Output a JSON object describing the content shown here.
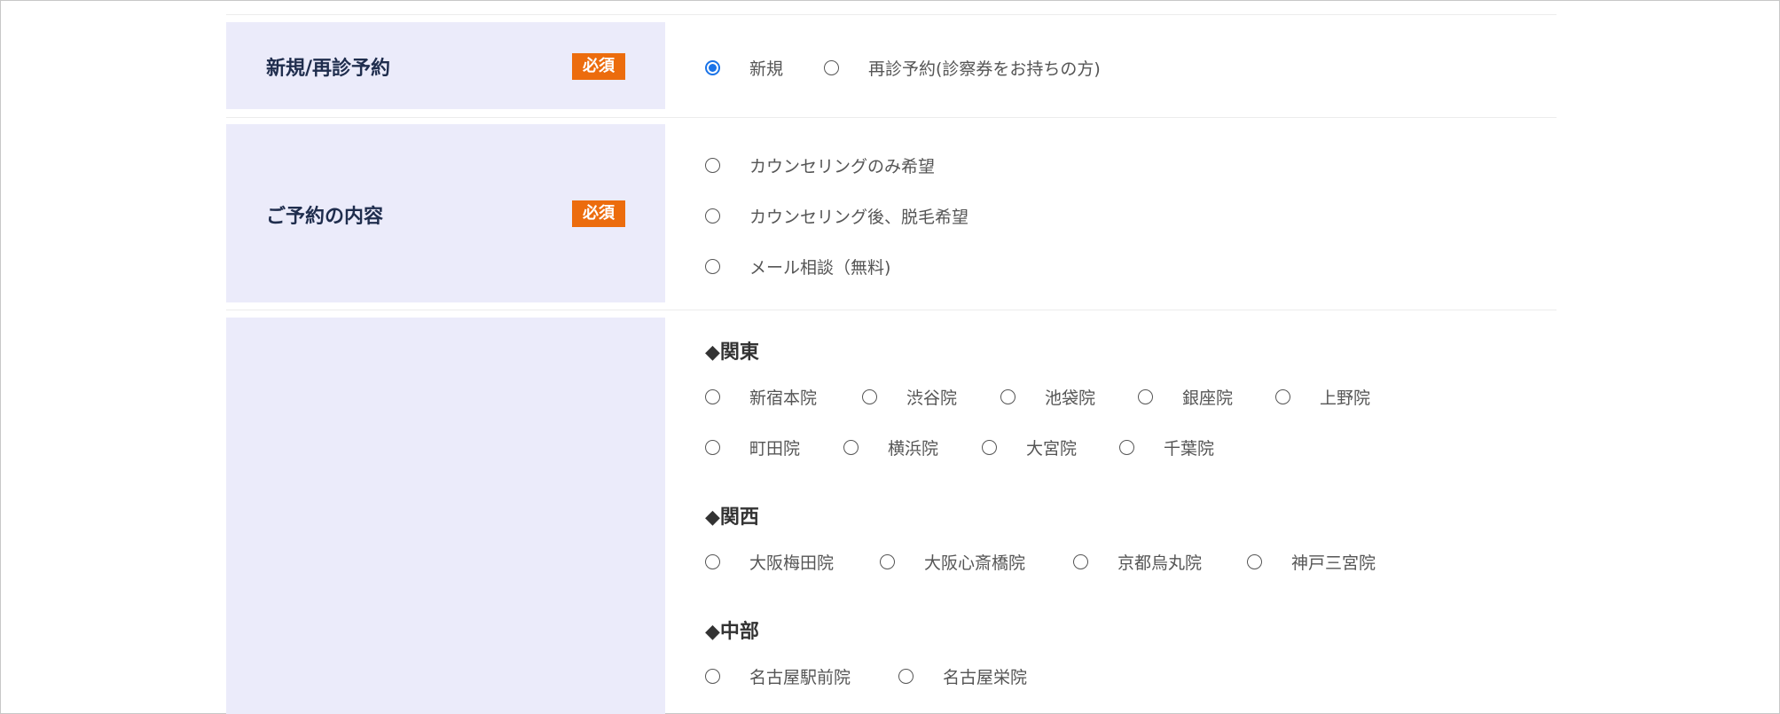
{
  "badge": "必須",
  "visit_type": {
    "label": "新規/再診予約",
    "options": [
      {
        "label": "新規",
        "selected": true
      },
      {
        "label": "再診予約(診察券をお持ちの方)",
        "selected": false
      }
    ]
  },
  "reservation": {
    "label": "ご予約の内容",
    "options": [
      {
        "label": "カウンセリングのみ希望",
        "selected": false
      },
      {
        "label": "カウンセリング後、脱毛希望",
        "selected": false
      },
      {
        "label": "メール相談（無料)",
        "selected": false
      }
    ]
  },
  "clinics": {
    "regions": [
      {
        "heading": "◆関東",
        "clinics": [
          "新宿本院",
          "渋谷院",
          "池袋院",
          "銀座院",
          "上野院",
          "町田院",
          "横浜院",
          "大宮院",
          "千葉院"
        ]
      },
      {
        "heading": "◆関西",
        "clinics": [
          "大阪梅田院",
          "大阪心斎橋院",
          "京都烏丸院",
          "神戸三宮院"
        ]
      },
      {
        "heading": "◆中部",
        "clinics": [
          "名古屋駅前院",
          "名古屋栄院"
        ]
      }
    ]
  },
  "colors": {
    "label_bg": "#ebebfa",
    "badge_bg": "#ec6c0d",
    "radio_selected": "#1a73e8"
  }
}
